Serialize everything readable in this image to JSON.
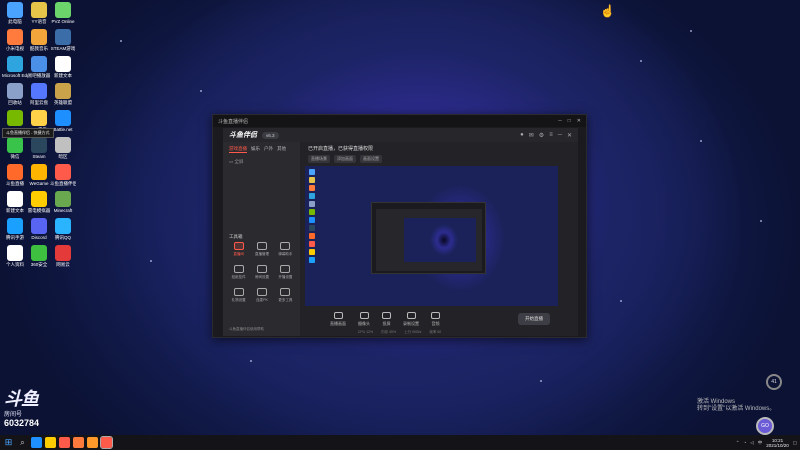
{
  "desktop": {
    "icons": [
      {
        "label": "此电脑",
        "color": "#4aa3ff"
      },
      {
        "label": "YY语音",
        "color": "#e6c44a"
      },
      {
        "label": "PVZ Online",
        "color": "#6bd46b"
      },
      {
        "label": "小米电视",
        "color": "#ff7a3d"
      },
      {
        "label": "酷我音乐",
        "color": "#f2a53a"
      },
      {
        "label": "STEAM游戏",
        "color": "#3b6ea8"
      },
      {
        "label": "Microsoft Edge",
        "color": "#2fa5e0"
      },
      {
        "label": "易吧播放器",
        "color": "#4a8fe8"
      },
      {
        "label": "新建文本",
        "color": "#ffffff"
      },
      {
        "label": "回收站",
        "color": "#8aa0c8"
      },
      {
        "label": "阿里云盘",
        "color": "#5577ff"
      },
      {
        "label": "英雄联盟",
        "color": "#c9a24a"
      },
      {
        "label": "GeForce Experience",
        "color": "#76b900"
      },
      {
        "label": "QQ音乐",
        "color": "#ffd24a"
      },
      {
        "label": "Battle.net",
        "color": "#1e8fff"
      },
      {
        "label": "微信",
        "color": "#39c34a"
      },
      {
        "label": "Steam",
        "color": "#2a475e"
      },
      {
        "label": "暗区",
        "color": "#c0c0c0"
      },
      {
        "label": "斗鱼直播",
        "color": "#ff6a2a"
      },
      {
        "label": "WeGame",
        "color": "#ffb400"
      },
      {
        "label": "斗鱼直播伴侣",
        "color": "#ff5a4a"
      },
      {
        "label": "新建文本",
        "color": "#ffffff"
      },
      {
        "label": "雷电模拟器",
        "color": "#ffcc00"
      },
      {
        "label": "Minecraft",
        "color": "#6aa84f"
      },
      {
        "label": "腾讯手游",
        "color": "#1aa0ff"
      },
      {
        "label": "Discord",
        "color": "#5865f2"
      },
      {
        "label": "腾讯QQ",
        "color": "#2ab4ff"
      },
      {
        "label": "个人资料",
        "color": "#ffffff"
      },
      {
        "label": "360安全",
        "color": "#3fbf3f"
      },
      {
        "label": "网易云",
        "color": "#e43a3a"
      }
    ],
    "tooltip": "斗鱼直播伴侣 - 快捷方式"
  },
  "window": {
    "title": "斗鱼直播伴侣",
    "controls": [
      "─",
      "□",
      "✕"
    ]
  },
  "app": {
    "logo": "斗鱼伴侣",
    "version_badge": "v6.3",
    "side_tabs": [
      "游戏直播",
      "娱乐",
      "户外",
      "其他"
    ],
    "side_row": "全屏",
    "tools_title": "工具箱",
    "tools": [
      {
        "label": "直播间",
        "active": true
      },
      {
        "label": "直播管理",
        "active": false
      },
      {
        "label": "弹幕助手",
        "active": false
      },
      {
        "label": "贴纸挂件",
        "active": false
      },
      {
        "label": "房间设置",
        "active": false
      },
      {
        "label": "开播设置",
        "active": false
      },
      {
        "label": "礼物设置",
        "active": false
      },
      {
        "label": "连麦PK",
        "active": false
      },
      {
        "label": "更多工具",
        "active": false
      }
    ],
    "side_footer": "斗鱼直播伴侣使用帮助",
    "stage_title": "已开启直播，已获得直播权限",
    "stage_buttons": [
      "直播场景",
      "添加画面",
      "画面设置"
    ],
    "bottom_tools": [
      "直播画面",
      "摄像头",
      "投屏",
      "录制设置",
      "音频"
    ],
    "start_label": "开始直播",
    "footer": [
      "CPU 12%",
      "内存 45%",
      "上行 0KB/s",
      "帧率 60"
    ]
  },
  "taskbar": {
    "apps": [
      "#1e90ff",
      "#ffcc00",
      "#ff5a4a",
      "#ff7a3d",
      "#ff9a2a",
      "#ff5a4a"
    ],
    "time": "10:21",
    "date": "2021/10/20",
    "tray_text": "中"
  },
  "overlay": {
    "logo": "斗鱼",
    "name": "房间号",
    "room_id": "6032784",
    "activate_line1": "激活 Windows",
    "activate_line2": "转到\"设置\"以激活 Windows。",
    "perf": "41",
    "assistant": "GO"
  }
}
